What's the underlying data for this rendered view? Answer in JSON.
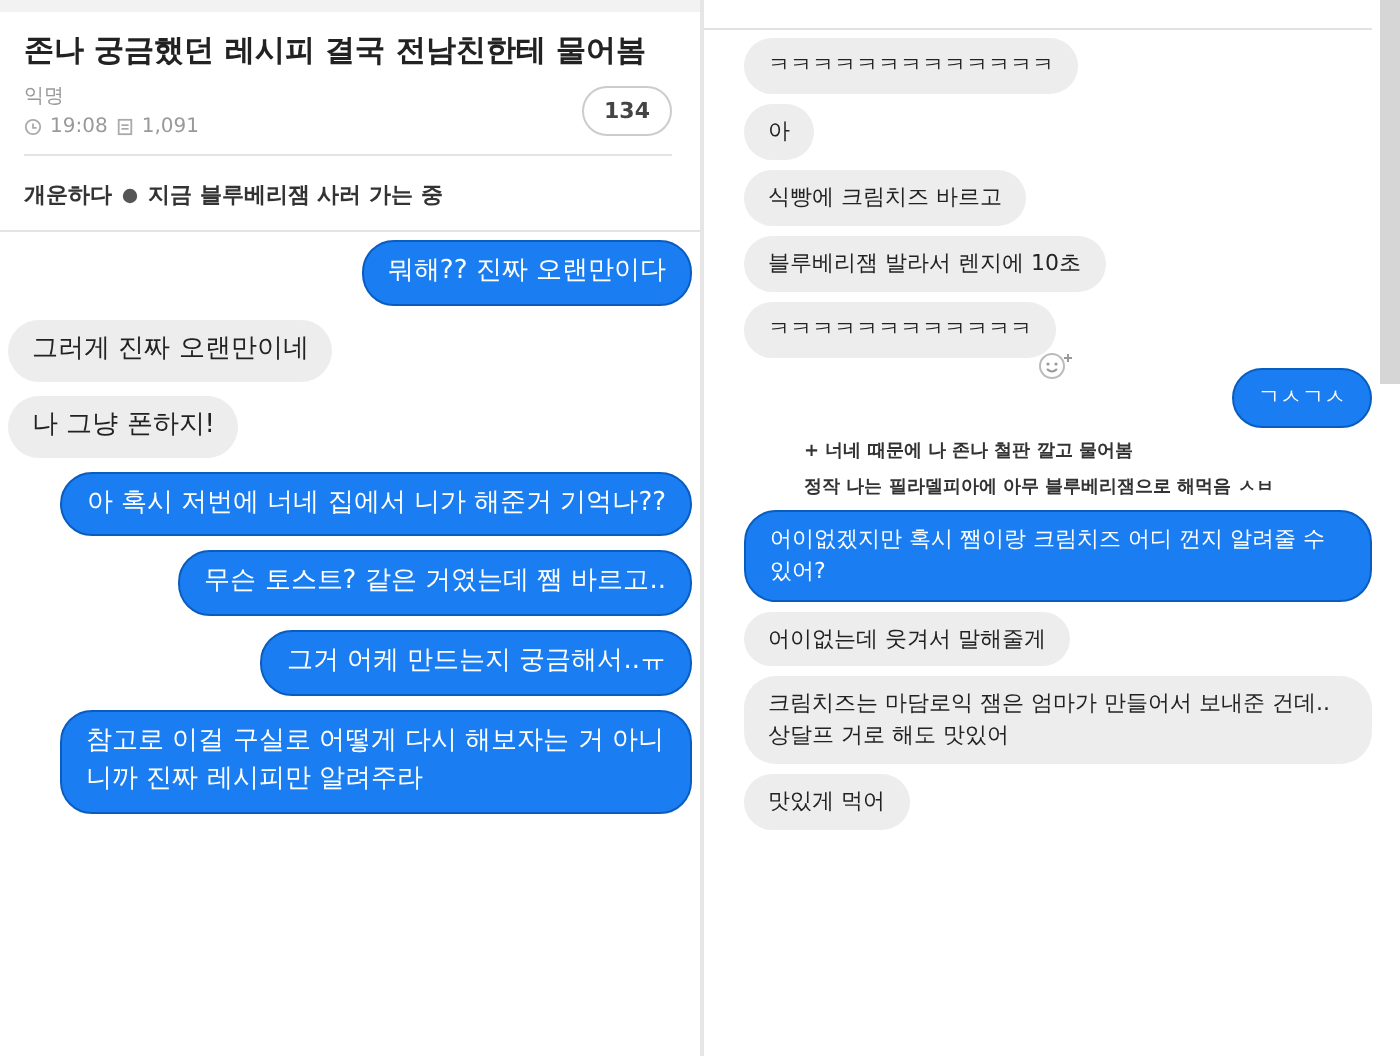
{
  "post": {
    "title": "존나 궁금했던 레시피 결국 전남친한테 물어봄",
    "author": "익명",
    "time": "19:08",
    "views": "1,091",
    "comments": "134",
    "body": [
      "개운하다",
      "지금 블루베리잼 사러 가는 중"
    ]
  },
  "chat_left": [
    {
      "kind": "sent",
      "text": "뭐해?? 진짜 오랜만이다"
    },
    {
      "kind": "received",
      "text": "그러게 진짜 오랜만이네"
    },
    {
      "kind": "received",
      "text": "나 그냥 폰하지!"
    },
    {
      "kind": "sent",
      "text": "아 혹시 저번에 너네 집에서 니가 해준거 기억나??"
    },
    {
      "kind": "sent",
      "text": "무슨 토스트? 같은 거였는데 쨈 바르고.."
    },
    {
      "kind": "sent",
      "text": "그거 어케 만드는지 궁금해서..ㅠ"
    },
    {
      "kind": "sent",
      "text": "참고로 이걸 구실로 어떻게 다시 해보자는 거 아니니까 진짜 레시피만 알려주라"
    }
  ],
  "chat_right": [
    {
      "kind": "received",
      "text": "ㅋㅋㅋㅋㅋㅋㅋㅋㅋㅋㅋㅋㅋ"
    },
    {
      "kind": "received",
      "text": "아"
    },
    {
      "kind": "received",
      "text": "식빵에 크림치즈 바르고"
    },
    {
      "kind": "received",
      "text": "블루베리잼 발라서 렌지에 10초"
    },
    {
      "kind": "received",
      "text": "ㅋㅋㅋㅋㅋㅋㅋㅋㅋㅋㅋㅋ",
      "reaction": true
    },
    {
      "kind": "sent",
      "text": "ㄱㅅㄱㅅ"
    },
    {
      "kind": "note",
      "text": "+ 너네 때문에 나 존나 철판 깔고 물어봄"
    },
    {
      "kind": "note",
      "text": "정작 나는 필라델피아에 아무 블루베리잼으로 해먹음 ㅅㅂ"
    },
    {
      "kind": "sent",
      "text": "어이없겠지만 혹시 쨈이랑 크림치즈 어디 껀지 알려줄 수 있어?"
    },
    {
      "kind": "received",
      "text": "어이없는데 웃겨서 말해줄게"
    },
    {
      "kind": "received",
      "text": "크림치즈는 마담로익 잼은 엄마가 만들어서 보내준 건데.. 상달프 거로 해도 맛있어"
    },
    {
      "kind": "received",
      "text": "맛있게 먹어"
    }
  ]
}
